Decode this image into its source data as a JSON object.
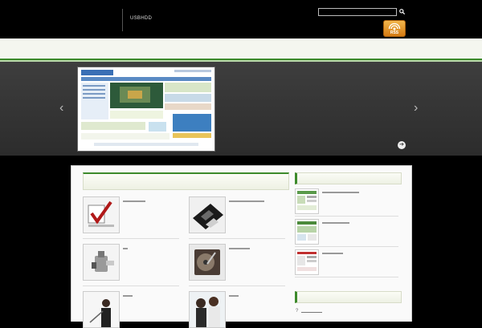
{
  "header": {
    "tagline": "USBHDD",
    "search": {
      "value": "",
      "placeholder": ""
    },
    "search_icon": "search-icon",
    "rss_label": "RSS"
  },
  "slider": {
    "prev_icon": "chevron-left-icon",
    "next_icon": "chevron-right-icon",
    "prev_glyph": "‹",
    "next_glyph": "›",
    "play_glyph": "➔",
    "slide_image": "website-screenshot"
  },
  "main": {
    "posts": [
      {
        "thumb": "checkmark-image"
      },
      {
        "thumb": "floppy-disk-image"
      },
      {
        "thumb": "usb-drive-image"
      },
      {
        "thumb": "hard-drive-image"
      },
      {
        "thumb": "presenter-image"
      },
      {
        "thumb": "office-workers-image"
      }
    ]
  },
  "sidebar": {
    "recent": [
      {
        "thumb": "web-page-thumb"
      },
      {
        "thumb": "web-page-thumb"
      },
      {
        "thumb": "web-page-thumb"
      }
    ],
    "link_bullet": "?"
  },
  "colors": {
    "accent_green": "#3c8a2b",
    "nav_bg": "#f4f6ef",
    "rss_orange": "#e9962a"
  }
}
